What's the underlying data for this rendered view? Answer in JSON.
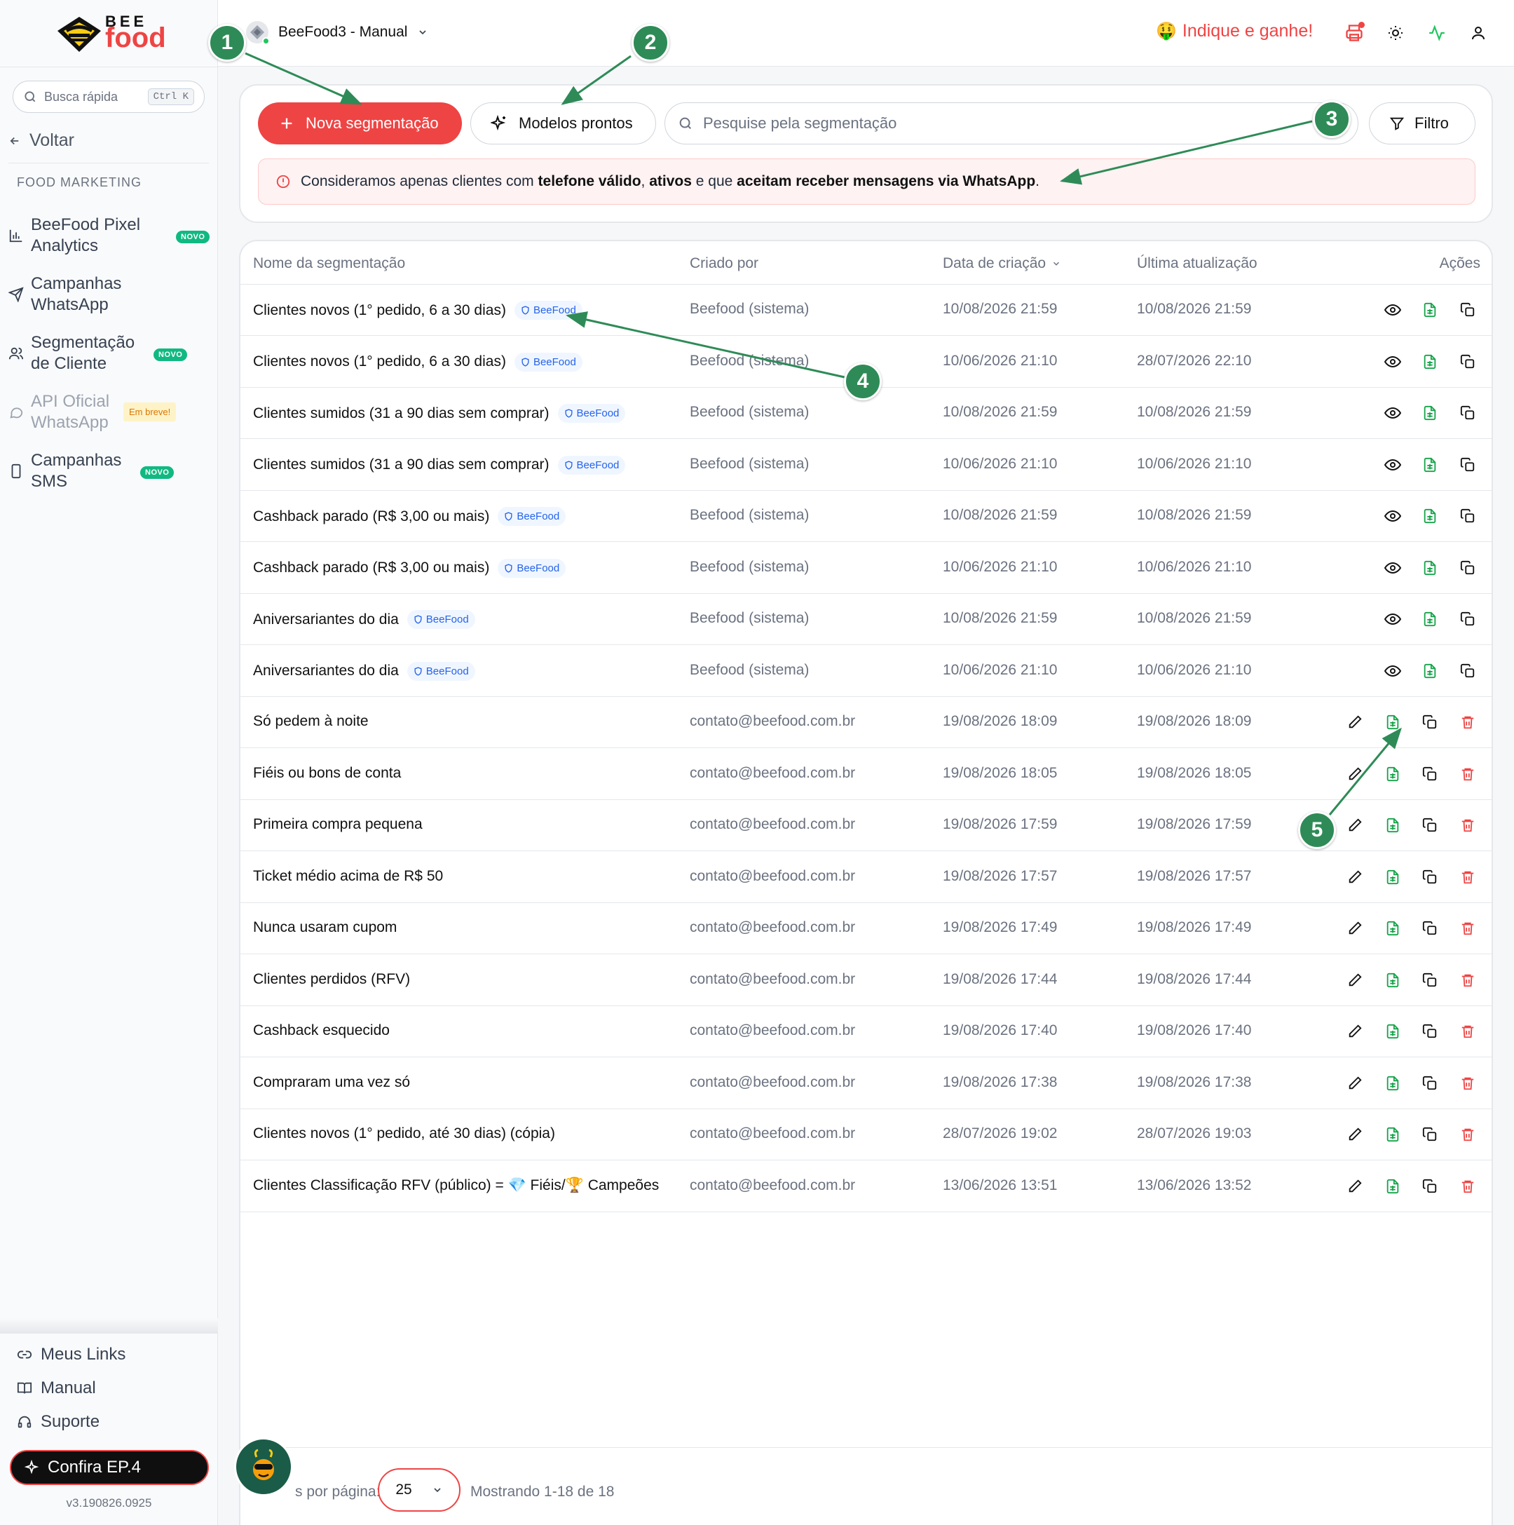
{
  "brand": {
    "top": "BEE",
    "bottom": "food"
  },
  "quick_search": {
    "placeholder": "Busca rápida",
    "shortcut": "Ctrl K"
  },
  "back_label": "Voltar",
  "section_title": "FOOD MARKETING",
  "nav": [
    {
      "label": "BeeFood Pixel Analytics",
      "icon": "bar-chart-icon",
      "badge": "NOVO"
    },
    {
      "label": "Campanhas WhatsApp",
      "icon": "send-icon",
      "badge": ""
    },
    {
      "label": "Segmentação de Cliente",
      "icon": "users-icon",
      "badge": "NOVO"
    },
    {
      "label": "API Oficial WhatsApp",
      "icon": "chat-icon",
      "badge": "Em breve!"
    },
    {
      "label": "Campanhas SMS",
      "icon": "phone-icon",
      "badge": "NOVO"
    }
  ],
  "footer_links": [
    {
      "label": "Meus Links",
      "icon": "link-icon"
    },
    {
      "label": "Manual",
      "icon": "book-icon"
    },
    {
      "label": "Suporte",
      "icon": "headset-icon"
    }
  ],
  "confira_label": "Confira EP.4",
  "version": "v3.190826.0925",
  "header": {
    "store_name": "BeeFood3 - Manual",
    "indique_emoji": "🤑",
    "indique_label": "Indique e ganhe!"
  },
  "toolbar": {
    "new_label": "Nova segmentação",
    "models_label": "Modelos prontos",
    "search_placeholder": "Pesquise pela segmentação",
    "filter_label": "Filtro"
  },
  "alert": {
    "p1": "Consideramos apenas clientes com ",
    "b1": "telefone válido",
    "p2": ", ",
    "b2": "ativos",
    "p3": " e que ",
    "b3": "aceitam receber mensagens via WhatsApp",
    "p4": "."
  },
  "table": {
    "headers": {
      "name": "Nome da segmentação",
      "created_by": "Criado por",
      "created_at": "Data de criação",
      "updated_at": "Última atualização",
      "actions": "Ações"
    },
    "tag_label": "BeeFood",
    "rows": [
      {
        "name": "Clientes novos (1° pedido, 6 a 30 dias)",
        "tag": true,
        "by": "Beefood (sistema)",
        "created": "10/08/2026 21:59",
        "updated": "10/08/2026 21:59",
        "system": true
      },
      {
        "name": "Clientes novos (1° pedido, 6 a 30 dias)",
        "tag": true,
        "by": "Beefood (sistema)",
        "created": "10/06/2026 21:10",
        "updated": "28/07/2026 22:10",
        "system": true
      },
      {
        "name": "Clientes sumidos (31 a 90 dias sem comprar)",
        "tag": true,
        "by": "Beefood (sistema)",
        "created": "10/08/2026 21:59",
        "updated": "10/08/2026 21:59",
        "system": true
      },
      {
        "name": "Clientes sumidos (31 a 90 dias sem comprar)",
        "tag": true,
        "by": "Beefood (sistema)",
        "created": "10/06/2026 21:10",
        "updated": "10/06/2026 21:10",
        "system": true
      },
      {
        "name": "Cashback parado (R$ 3,00 ou mais)",
        "tag": true,
        "by": "Beefood (sistema)",
        "created": "10/08/2026 21:59",
        "updated": "10/08/2026 21:59",
        "system": true
      },
      {
        "name": "Cashback parado (R$ 3,00 ou mais)",
        "tag": true,
        "by": "Beefood (sistema)",
        "created": "10/06/2026 21:10",
        "updated": "10/06/2026 21:10",
        "system": true
      },
      {
        "name": "Aniversariantes do dia",
        "tag": true,
        "by": "Beefood (sistema)",
        "created": "10/08/2026 21:59",
        "updated": "10/08/2026 21:59",
        "system": true
      },
      {
        "name": "Aniversariantes do dia",
        "tag": true,
        "by": "Beefood (sistema)",
        "created": "10/06/2026 21:10",
        "updated": "10/06/2026 21:10",
        "system": true
      },
      {
        "name": "Só pedem à noite",
        "tag": false,
        "by": "contato@beefood.com.br",
        "created": "19/08/2026 18:09",
        "updated": "19/08/2026 18:09",
        "system": false
      },
      {
        "name": "Fiéis ou bons de conta",
        "tag": false,
        "by": "contato@beefood.com.br",
        "created": "19/08/2026 18:05",
        "updated": "19/08/2026 18:05",
        "system": false
      },
      {
        "name": "Primeira compra pequena",
        "tag": false,
        "by": "contato@beefood.com.br",
        "created": "19/08/2026 17:59",
        "updated": "19/08/2026 17:59",
        "system": false
      },
      {
        "name": "Ticket médio acima de R$ 50",
        "tag": false,
        "by": "contato@beefood.com.br",
        "created": "19/08/2026 17:57",
        "updated": "19/08/2026 17:57",
        "system": false
      },
      {
        "name": "Nunca usaram cupom",
        "tag": false,
        "by": "contato@beefood.com.br",
        "created": "19/08/2026 17:49",
        "updated": "19/08/2026 17:49",
        "system": false
      },
      {
        "name": "Clientes perdidos (RFV)",
        "tag": false,
        "by": "contato@beefood.com.br",
        "created": "19/08/2026 17:44",
        "updated": "19/08/2026 17:44",
        "system": false
      },
      {
        "name": "Cashback esquecido",
        "tag": false,
        "by": "contato@beefood.com.br",
        "created": "19/08/2026 17:40",
        "updated": "19/08/2026 17:40",
        "system": false
      },
      {
        "name": "Compraram uma vez só",
        "tag": false,
        "by": "contato@beefood.com.br",
        "created": "19/08/2026 17:38",
        "updated": "19/08/2026 17:38",
        "system": false
      },
      {
        "name": "Clientes novos (1° pedido, até 30 dias) (cópia)",
        "tag": false,
        "by": "contato@beefood.com.br",
        "created": "28/07/2026 19:02",
        "updated": "28/07/2026 19:03",
        "system": false
      },
      {
        "name": "Clientes Classificação RFV (público) = 💎 Fiéis/🏆 Campeões",
        "tag": false,
        "by": "contato@beefood.com.br",
        "created": "13/06/2026 13:51",
        "updated": "13/06/2026 13:52",
        "system": false
      }
    ]
  },
  "pagination": {
    "per_page_label": "s por página:",
    "per_page_value": "25",
    "showing": "Mostrando 1-18 de 18"
  },
  "callouts": [
    "1",
    "2",
    "3",
    "4",
    "5"
  ],
  "colors": {
    "accent": "#ef4444",
    "callout": "#2e8b57",
    "tag": "#2563eb",
    "novo": "#10b981"
  }
}
